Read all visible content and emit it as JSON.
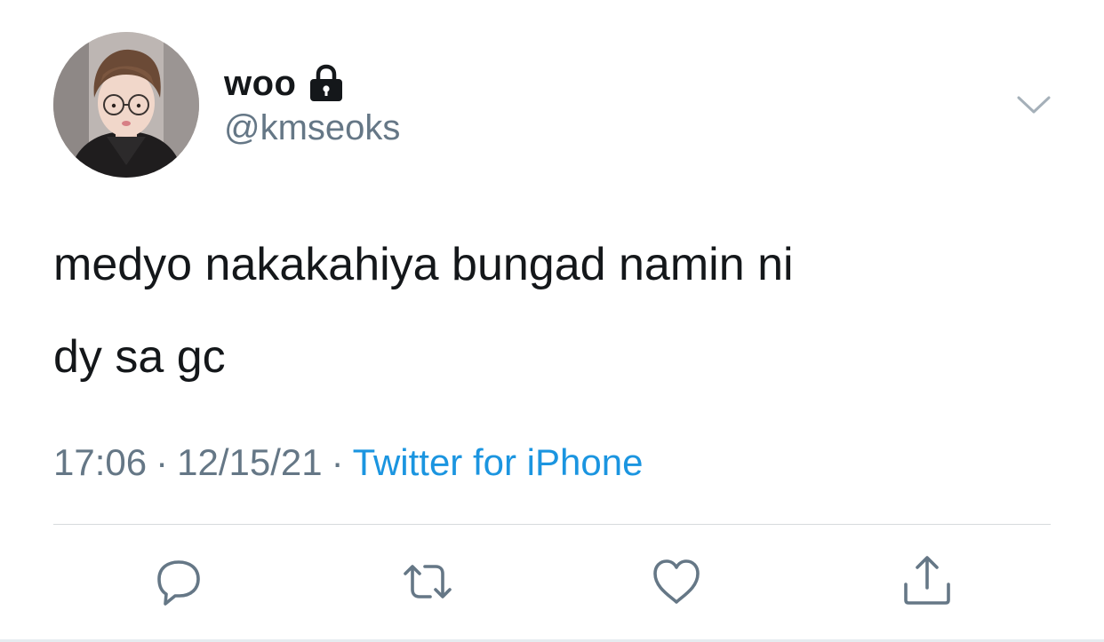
{
  "user": {
    "display_name": "woo",
    "handle": "@kmseoks",
    "protected_icon": "lock-icon",
    "avatar": "profile-photo"
  },
  "menu": {
    "icon": "chevron-down-icon"
  },
  "tweet": {
    "text_line1": "medyo nakakahiya bungad namin ni",
    "text_line2": "dy sa gc",
    "time": "17:06",
    "separator": "·",
    "date": "12/15/21",
    "source": "Twitter for iPhone"
  },
  "actions": {
    "reply_icon": "reply-bubble-icon",
    "retweet_icon": "retweet-icon",
    "like_icon": "heart-icon",
    "share_icon": "share-upload-icon"
  },
  "colors": {
    "text": "#14171a",
    "secondary": "#657786",
    "link": "#1b95e0",
    "icon": "#657786"
  }
}
